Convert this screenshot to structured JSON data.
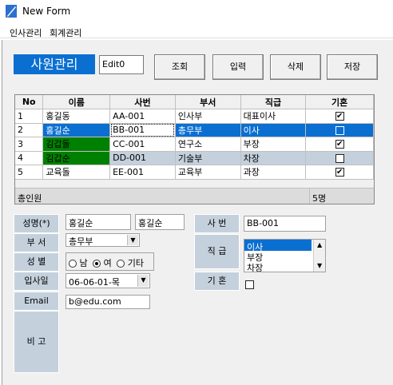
{
  "window": {
    "title": "New Form"
  },
  "menu": {
    "items": [
      "인사관리",
      "회계관리"
    ]
  },
  "heading": "사원관리",
  "edit0": "Edit0",
  "buttons": {
    "query": "조회",
    "input": "입력",
    "delete": "삭제",
    "save": "저장"
  },
  "grid": {
    "columns": [
      "No",
      "이름",
      "사번",
      "부서",
      "직급",
      "기혼"
    ],
    "rows": [
      {
        "no": "1",
        "name": "홍길동",
        "id": "AA-001",
        "dept": "인사부",
        "rank": "대표이사",
        "married": true,
        "style": "normal"
      },
      {
        "no": "2",
        "name": "홍길순",
        "id": "BB-001",
        "dept": "총무부",
        "rank": "이사",
        "married": false,
        "style": "selected"
      },
      {
        "no": "3",
        "name": "김갑돌",
        "id": "CC-001",
        "dept": "연구소",
        "rank": "부장",
        "married": true,
        "style": "green"
      },
      {
        "no": "4",
        "name": "김갑순",
        "id": "DD-001",
        "dept": "기술부",
        "rank": "차장",
        "married": false,
        "style": "green-alt"
      },
      {
        "no": "5",
        "name": "교육돌",
        "id": "EE-001",
        "dept": "교육부",
        "rank": "과장",
        "married": true,
        "style": "normal"
      }
    ],
    "summary_label": "총인원",
    "summary_count": "5명"
  },
  "form": {
    "name_label": "성명(*)",
    "name_value": "홍길순",
    "name_value2": "홍길순",
    "dept_label": "부 서",
    "dept_value": "총무부",
    "gender_label": "성 별",
    "gender_options": [
      "남",
      "여",
      "기타"
    ],
    "gender_selected": "여",
    "join_label": "입사일",
    "join_value": "06-06-01-목",
    "email_label": "Email",
    "email_value": "b@edu.com",
    "note_label": "비 고",
    "id_label": "사 번",
    "id_value": "BB-001",
    "rank_label": "직 급",
    "rank_options": [
      "이사",
      "부장",
      "차장"
    ],
    "married_label": "기 혼"
  },
  "colors": {
    "accent": "#0a6fd1",
    "label_bg": "#c4d1dd",
    "green": "#008000"
  }
}
